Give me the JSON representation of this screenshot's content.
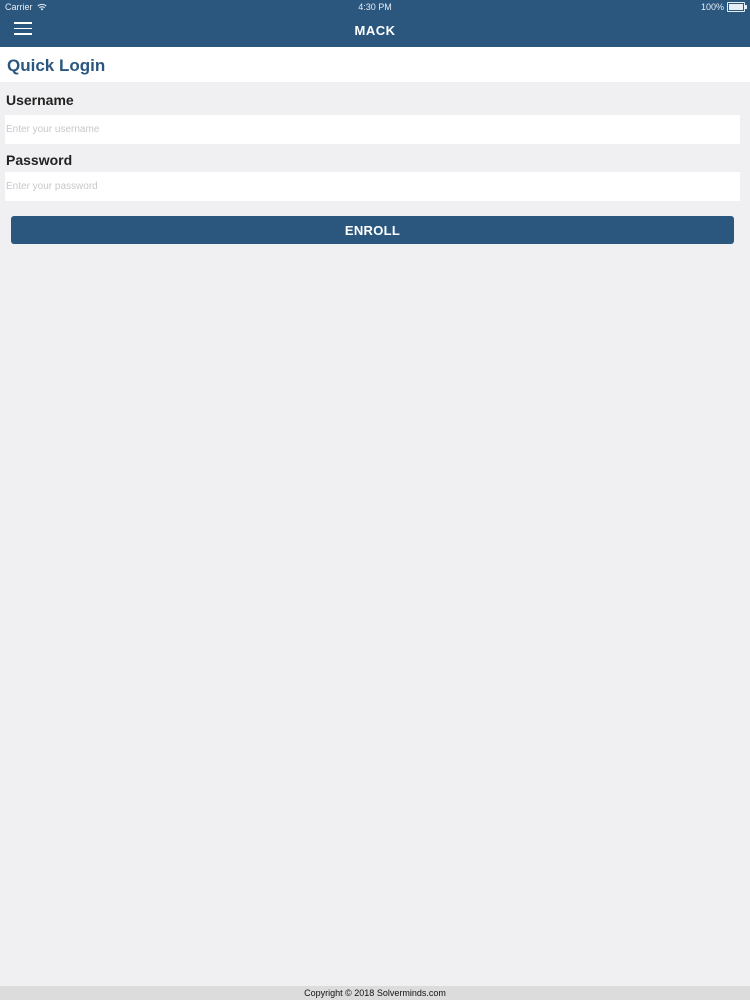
{
  "status_bar": {
    "carrier": "Carrier",
    "time": "4:30 PM",
    "battery_percent": "100%",
    "battery_level": 1.0,
    "wifi_icon": "wifi-icon",
    "battery_icon": "battery-icon"
  },
  "nav": {
    "title": "MACK",
    "menu_icon": "hamburger-menu-icon"
  },
  "section": {
    "title": "Quick Login"
  },
  "form": {
    "username_label": "Username",
    "username_value": "",
    "username_placeholder": "Enter your username",
    "password_label": "Password",
    "password_value": "",
    "password_placeholder": "Enter your password",
    "submit_label": "ENROLL"
  },
  "footer": {
    "copyright": "Copyright © 2018 Solverminds.com"
  },
  "colors": {
    "primary": "#2b577f",
    "background": "#f0eff1",
    "footer_background": "#dcdcdc"
  }
}
